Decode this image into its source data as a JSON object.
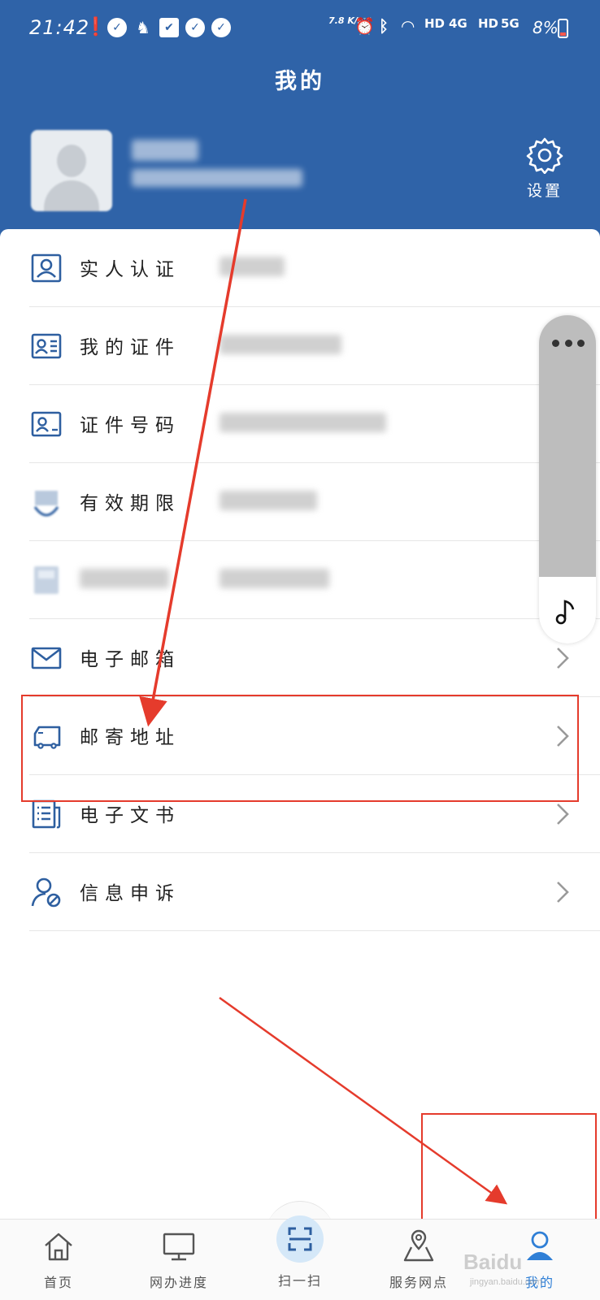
{
  "status_bar": {
    "time": "21:42",
    "network_speed": "7.8 K/s",
    "wifi_label": "HD",
    "sim1_label": "4G",
    "sim1_hd": "HD",
    "sim2_label": "5G",
    "battery": "8%"
  },
  "header": {
    "title": "我的",
    "settings_label": "设置"
  },
  "profile": {
    "name": "",
    "subtitle": ""
  },
  "menu": [
    {
      "label": "实人认证",
      "icon": "id-person-icon",
      "has_chevron": false
    },
    {
      "label": "我的证件",
      "icon": "id-card-icon",
      "has_chevron": false
    },
    {
      "label": "证件号码",
      "icon": "id-number-icon",
      "has_chevron": false
    },
    {
      "label": "有效期限",
      "icon": "validity-icon",
      "has_chevron": false
    },
    {
      "label": "",
      "icon": "blurred-icon",
      "has_chevron": false
    },
    {
      "label": "电子邮箱",
      "icon": "mail-icon",
      "has_chevron": true
    },
    {
      "label": "邮寄地址",
      "icon": "truck-icon",
      "has_chevron": true
    },
    {
      "label": "电子文书",
      "icon": "document-icon",
      "has_chevron": true
    },
    {
      "label": "信息申诉",
      "icon": "user-block-icon",
      "has_chevron": true
    }
  ],
  "bottom_nav": [
    {
      "label": "首页",
      "icon": "home-icon"
    },
    {
      "label": "网办进度",
      "icon": "monitor-icon"
    },
    {
      "label": "扫一扫",
      "icon": "scan-icon"
    },
    {
      "label": "服务网点",
      "icon": "map-pin-icon"
    },
    {
      "label": "我的",
      "icon": "user-icon",
      "active": true
    }
  ],
  "watermark": {
    "brand": "Baidu",
    "sub": "jingyan.baidu.com"
  },
  "colors": {
    "header_blue": "#2f63a8",
    "icon_blue": "#2e5fa0",
    "annotation_red": "#e53b2c",
    "active_nav": "#2f7fd6"
  }
}
